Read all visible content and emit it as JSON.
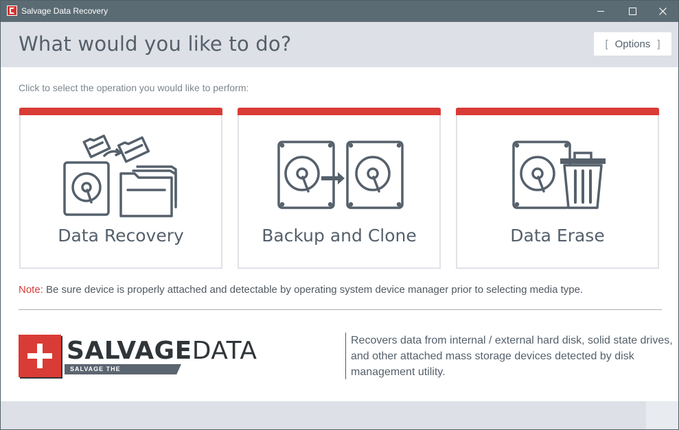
{
  "window": {
    "title": "Salvage Data Recovery"
  },
  "header": {
    "title": "What would you like to do?",
    "options_label": "Options"
  },
  "main": {
    "instruction": "Click to select the operation you would like to perform:",
    "cards": [
      {
        "label": "Data Recovery",
        "icon": "data-recovery-icon"
      },
      {
        "label": "Backup and Clone",
        "icon": "backup-clone-icon"
      },
      {
        "label": "Data Erase",
        "icon": "data-erase-icon"
      }
    ],
    "note_label": "Note:",
    "note_text": " Be sure device is properly attached and detectable by operating system device manager prior to selecting media type."
  },
  "branding": {
    "logo_bold": "SALVAGE",
    "logo_light": "DATA",
    "tagline": "SALVAGE THE UNRECOVERABLE",
    "description": "Recovers data from internal / external hard disk, solid state drives, and other attached mass storage devices detected by disk management utility."
  },
  "colors": {
    "accent": "#d93b36",
    "titlebar": "#5b6b74",
    "header_bg": "#dde0e6",
    "icon": "#55606b"
  }
}
